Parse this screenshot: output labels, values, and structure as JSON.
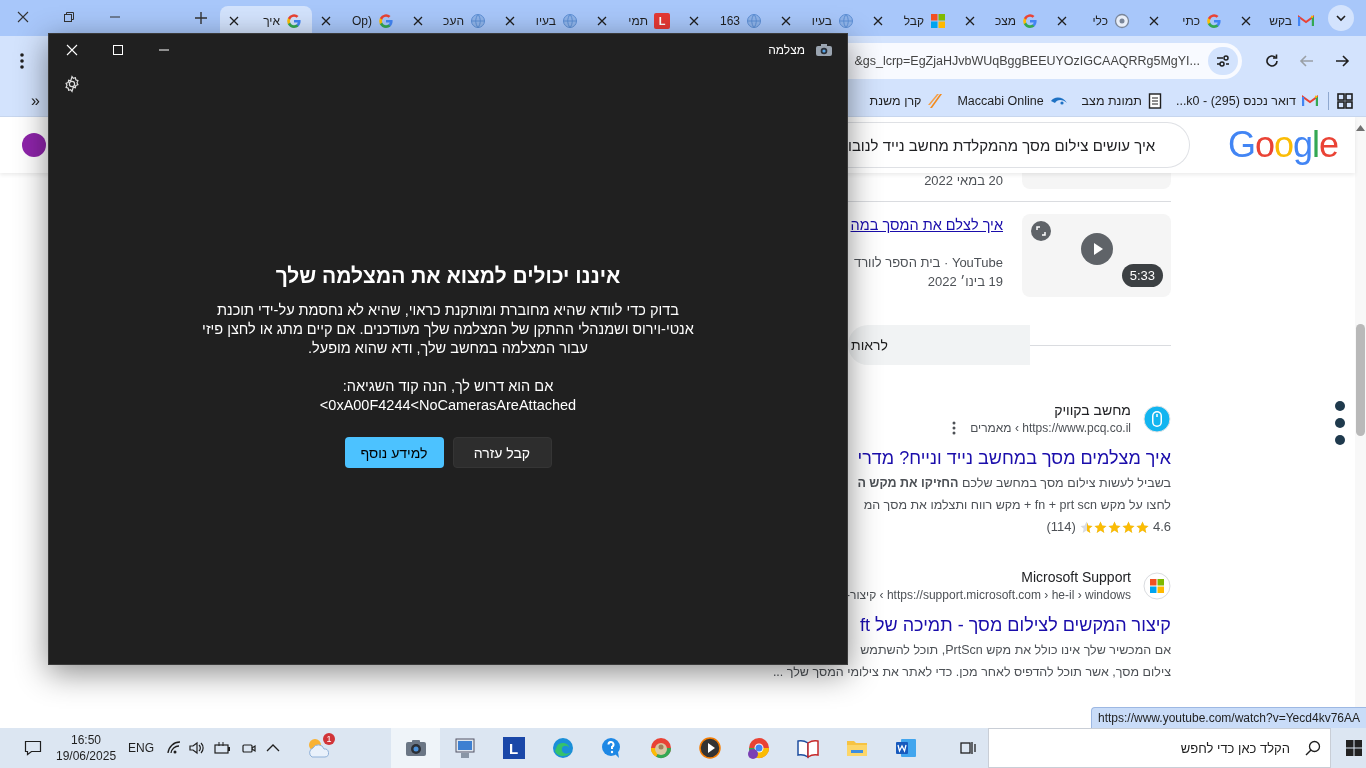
{
  "browser": {
    "tabs": [
      {
        "label": "בקש",
        "kind": "mail",
        "selected": false
      },
      {
        "label": "כתי",
        "kind": "google",
        "selected": false
      },
      {
        "label": "כלי",
        "kind": "circle",
        "selected": false
      },
      {
        "label": "מצכ",
        "kind": "google",
        "selected": false
      },
      {
        "label": "קבל",
        "kind": "microsoft",
        "selected": false
      },
      {
        "label": "בעיו",
        "kind": "globe",
        "selected": false
      },
      {
        "label": "163",
        "kind": "globe",
        "selected": false
      },
      {
        "label": "תמי",
        "kind": "letter",
        "icon_letter": "L",
        "selected": false
      },
      {
        "label": "בעיו",
        "kind": "globe",
        "selected": false
      },
      {
        "label": "העכ",
        "kind": "globe",
        "selected": false
      },
      {
        "label": "(Op",
        "kind": "google",
        "selected": false
      },
      {
        "label": "איך",
        "kind": "google",
        "selected": true
      }
    ],
    "address": "&gs_lcrp=EgZjaHJvbWUqBggBEEUYOzIGCAAQRRg5MgYI...",
    "forward_disabled": true,
    "bookmarks_overflow": "»",
    "bookmarks": [
      {
        "label": "דואר נכנס (295) - k0...",
        "kind": "mail"
      },
      {
        "label": "תמונת מצב",
        "kind": "document"
      },
      {
        "label": "Maccabi Online",
        "kind": "swoosh"
      },
      {
        "label": "קרן משנת",
        "kind": "leaf"
      }
    ]
  },
  "search_page": {
    "logo": "Google",
    "query": "איך עושים צילום מסך מהמקלדת מחשב נייד לנובו",
    "prev_video_date": "20 במאי 2022",
    "video": {
      "title": "איך לצלם את המסך במה",
      "source": "YouTube · בית הספר לוורד",
      "date": "19 בינו׳ 2022",
      "duration": "5:33"
    },
    "more_button": "לראות",
    "results": [
      {
        "kind": "mouse",
        "site": "מחשב בקוויק",
        "url": "https://www.pcq.co.il › מאמרים",
        "title": "איך מצלמים מסך במחשב נייד ונייח? מדרי",
        "snippet": [
          "בשביל לעשות צילום מסך במחשב שלכם **החזיקו את מקש ה**",
          "לחצו על מקש fn + prt scn + מקש רווח ותצלמו את מסך המ"
        ],
        "rating": "4.6",
        "stars": 4.6,
        "reviews": "(114)"
      },
      {
        "kind": "microsoft",
        "site": "Microsoft Support",
        "url": "https://support.microsoft.com › he-il › windows › קיצור-",
        "title": "קיצור המקשים לצילום מסך - תמיכה של ft",
        "snippet": [
          "אם המכשיר שלך אינו כולל את מקש PrtScn, תוכל להשתמש",
          "צילום מסך, אשר תוכל להדפיס לאחר מכן. כדי לאתר את צילומי המסך שלך ..."
        ]
      }
    ]
  },
  "status_url": "https://www.youtube.com/watch?v=Yecd4kv76AA",
  "camera_app": {
    "title": "מצלמה",
    "heading": "איננו יכולים למצוא את המצלמה שלך",
    "body": "בדוק כדי לוודא שהיא מחוברת ומותקנת כראוי, שהיא לא נחסמת על-ידי תוכנת אנטי-וירוס ושמנהלי ההתקן של המצלמה שלך מעודכנים. אם קיים מתג או לחצן פיזי עבור המצלמה במחשב שלך, ודא שהוא מופעל.",
    "error_label": "אם הוא דרוש לך, הנה קוד השגיאה:",
    "error_code": "<0xA00F4244<NoCamerasAreAttached",
    "buttons": [
      {
        "label": "קבל עזרה",
        "kind": "secondary"
      },
      {
        "label": "למידע נוסף",
        "kind": "primary"
      }
    ]
  },
  "taskbar": {
    "time": "16:50",
    "date": "19/06/2025",
    "language": "ENG",
    "weather_badge": "1",
    "apps": [
      {
        "kind": "camera",
        "active": true
      },
      {
        "kind": "computer",
        "active": false
      },
      {
        "kind": "letter",
        "letter": "L",
        "active": false
      },
      {
        "kind": "edge",
        "active": false
      },
      {
        "kind": "help",
        "active": false
      },
      {
        "kind": "photos",
        "active": false
      },
      {
        "kind": "player",
        "active": false
      },
      {
        "kind": "chrome",
        "active": false
      },
      {
        "kind": "book",
        "active": false
      },
      {
        "kind": "folder",
        "active": false
      },
      {
        "kind": "word",
        "active": false
      }
    ],
    "search_placeholder": "הקלד כאן כדי לחפש"
  }
}
